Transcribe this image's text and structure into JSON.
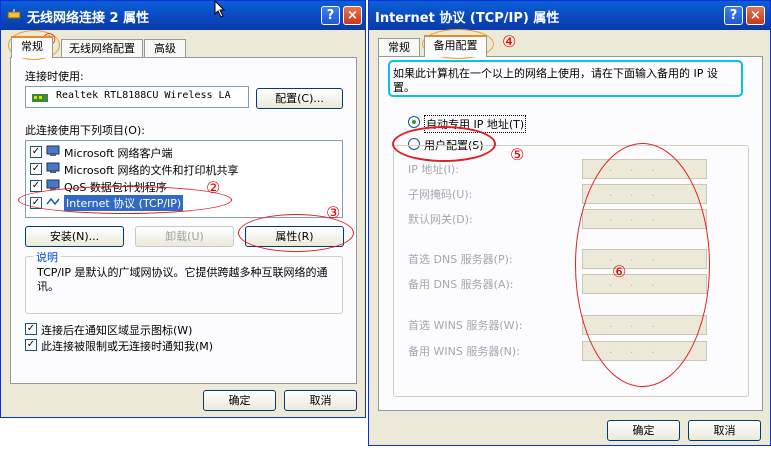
{
  "left_window": {
    "title": "无线网络连接 2 属性",
    "tabs": [
      "常规",
      "无线网络配置",
      "高级"
    ],
    "connect_using_label": "连接时使用:",
    "adapter_name": "Realtek RTL8188CU Wireless LA",
    "configure_button": "配置(C)...",
    "items_label": "此连接使用下列项目(O):",
    "items": [
      {
        "label": "Microsoft 网络客户端",
        "checked": true
      },
      {
        "label": "Microsoft 网络的文件和打印机共享",
        "checked": true
      },
      {
        "label": "QoS 数据包计划程序",
        "checked": true
      },
      {
        "label": "Internet 协议 (TCP/IP)",
        "checked": true
      }
    ],
    "install_button": "安装(N)...",
    "uninstall_button": "卸载(U)",
    "properties_button": "属性(R)",
    "description_title": "说明",
    "description_text": "TCP/IP 是默认的广域网协议。它提供跨越多种互联网络的通讯。",
    "option1": "连接后在通知区域显示图标(W)",
    "option2": "此连接被限制或无连接时通知我(M)",
    "ok_button": "确定",
    "cancel_button": "取消"
  },
  "right_window": {
    "title": "Internet 协议 (TCP/IP) 属性",
    "tabs": [
      "常规",
      "备用配置"
    ],
    "info_text": "如果此计算机在一个以上的网络上使用，请在下面输入备用的 IP 设置。",
    "radio_auto": "自动专用 IP 地址(T)",
    "radio_user": "用户配置(S)",
    "fields": [
      "IP 地址(I):",
      "子网掩码(U):",
      "默认网关(D):",
      "首选 DNS 服务器(P):",
      "备用 DNS 服务器(A):",
      "首选 WINS 服务器(W):",
      "备用 WINS 服务器(N):"
    ],
    "ok_button": "确定",
    "cancel_button": "取消"
  },
  "titlebar_buttons": {
    "help": "?",
    "close": "×"
  },
  "annotations": [
    "①",
    "②",
    "③",
    "④",
    "⑤",
    "⑥"
  ],
  "colors": {
    "titlebar": "#0a55d0",
    "annotation": "#e00000",
    "highlight_oval": "#00c8e0",
    "tab_oval": "#f0a020"
  }
}
